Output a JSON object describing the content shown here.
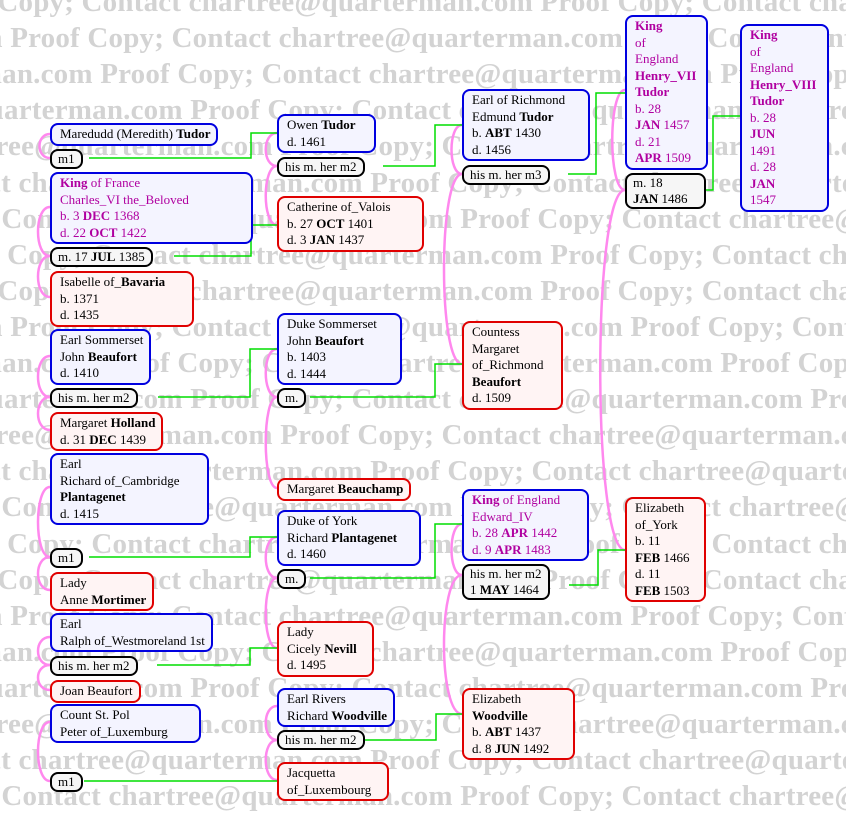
{
  "watermark": {
    "text": "Proof Copy; Contact chartree@quarterman.com"
  },
  "colors": {
    "male_border": "#0000e0",
    "female_border": "#e00000",
    "marriage_border": "#000000",
    "royal_text": "#b000a0",
    "descent_line": "#00dd00",
    "spouse_line": "#ff88ee",
    "watermark": "#d3d3d3"
  },
  "people": {
    "maredudd": {
      "lines": [
        {
          "pre": "Maredudd (Meredith) ",
          "bold": "Tudor",
          "post": ""
        }
      ]
    },
    "charles_vi": {
      "royal": true,
      "lines": [
        {
          "pre": "",
          "bold": "King",
          "post": " of France"
        },
        {
          "pre": "Charles_VI the_Beloved",
          "bold": "",
          "post": ""
        },
        {
          "pre": "b. 3 ",
          "bold": "DEC",
          "post": " 1368"
        },
        {
          "pre": "d. 22 ",
          "bold": "OCT",
          "post": " 1422"
        }
      ]
    },
    "isabelle": {
      "lines": [
        {
          "pre": "Isabelle of_",
          "bold": "Bavaria",
          "post": ""
        },
        {
          "pre": "b. 1371",
          "bold": "",
          "post": ""
        },
        {
          "pre": "d. 1435",
          "bold": "",
          "post": ""
        }
      ]
    },
    "john_beaufort_earl": {
      "lines": [
        {
          "pre": "Earl Sommerset",
          "bold": "",
          "post": ""
        },
        {
          "pre": "John ",
          "bold": "Beaufort",
          "post": ""
        },
        {
          "pre": "d. 1410",
          "bold": "",
          "post": ""
        }
      ]
    },
    "margaret_holland": {
      "lines": [
        {
          "pre": "Margaret ",
          "bold": "Holland",
          "post": ""
        },
        {
          "pre": "d. 31 ",
          "bold": "DEC",
          "post": " 1439"
        }
      ]
    },
    "richard_cambridge": {
      "lines": [
        {
          "pre": "Earl",
          "bold": "",
          "post": ""
        },
        {
          "pre": "Richard of_Cambridge",
          "bold": "",
          "post": ""
        },
        {
          "pre": "",
          "bold": "Plantagenet",
          "post": ""
        },
        {
          "pre": "d. 1415",
          "bold": "",
          "post": ""
        }
      ]
    },
    "anne_mortimer": {
      "lines": [
        {
          "pre": "Lady",
          "bold": "",
          "post": ""
        },
        {
          "pre": "Anne ",
          "bold": "Mortimer",
          "post": ""
        }
      ]
    },
    "ralph_westmoreland": {
      "lines": [
        {
          "pre": "Earl",
          "bold": "",
          "post": ""
        },
        {
          "pre": "Ralph of_Westmoreland 1st",
          "bold": "",
          "post": ""
        }
      ]
    },
    "joan_beaufort": {
      "lines": [
        {
          "pre": "Joan Beaufort",
          "bold": "",
          "post": ""
        }
      ]
    },
    "peter_luxemburg": {
      "lines": [
        {
          "pre": "Count St. Pol",
          "bold": "",
          "post": ""
        },
        {
          "pre": "Peter of_Luxemburg",
          "bold": "",
          "post": ""
        }
      ]
    },
    "owen_tudor": {
      "lines": [
        {
          "pre": "Owen ",
          "bold": "Tudor",
          "post": ""
        },
        {
          "pre": "d. 1461",
          "bold": "",
          "post": ""
        }
      ]
    },
    "catherine_valois": {
      "lines": [
        {
          "pre": "Catherine of_Valois",
          "bold": "",
          "post": ""
        },
        {
          "pre": "b. 27 ",
          "bold": "OCT",
          "post": " 1401"
        },
        {
          "pre": "d. 3 ",
          "bold": "JAN",
          "post": " 1437"
        }
      ]
    },
    "john_beaufort_duke": {
      "lines": [
        {
          "pre": "Duke Sommerset",
          "bold": "",
          "post": ""
        },
        {
          "pre": "John ",
          "bold": "Beaufort",
          "post": ""
        },
        {
          "pre": "b. 1403",
          "bold": "",
          "post": ""
        },
        {
          "pre": "d. 1444",
          "bold": "",
          "post": ""
        }
      ]
    },
    "margaret_beauchamp": {
      "lines": [
        {
          "pre": "Margaret ",
          "bold": "Beauchamp",
          "post": ""
        }
      ]
    },
    "richard_york": {
      "lines": [
        {
          "pre": "Duke of York",
          "bold": "",
          "post": ""
        },
        {
          "pre": "Richard ",
          "bold": "Plantagenet",
          "post": ""
        },
        {
          "pre": "d. 1460",
          "bold": "",
          "post": ""
        }
      ]
    },
    "cicely_nevill": {
      "lines": [
        {
          "pre": "Lady",
          "bold": "",
          "post": ""
        },
        {
          "pre": "Cicely ",
          "bold": "Nevill",
          "post": ""
        },
        {
          "pre": "d. 1495",
          "bold": "",
          "post": ""
        }
      ]
    },
    "richard_woodville": {
      "lines": [
        {
          "pre": "Earl Rivers",
          "bold": "",
          "post": ""
        },
        {
          "pre": "Richard ",
          "bold": "Woodville",
          "post": ""
        }
      ]
    },
    "jacquetta": {
      "lines": [
        {
          "pre": "Jacquetta",
          "bold": "",
          "post": ""
        },
        {
          "pre": "of_Luxembourg",
          "bold": "",
          "post": ""
        }
      ]
    },
    "edmund_tudor": {
      "lines": [
        {
          "pre": "Earl of Richmond",
          "bold": "",
          "post": ""
        },
        {
          "pre": "Edmund ",
          "bold": "Tudor",
          "post": ""
        },
        {
          "pre": "b. ",
          "bold": "ABT",
          "post": " 1430"
        },
        {
          "pre": "d. 1456",
          "bold": "",
          "post": ""
        }
      ]
    },
    "margaret_beaufort": {
      "lines": [
        {
          "pre": "Countess",
          "bold": "",
          "post": ""
        },
        {
          "pre": "Margaret",
          "bold": "",
          "post": ""
        },
        {
          "pre": "of_Richmond",
          "bold": "",
          "post": ""
        },
        {
          "pre": "",
          "bold": "Beaufort",
          "post": ""
        },
        {
          "pre": "d. 1509",
          "bold": "",
          "post": ""
        }
      ]
    },
    "edward_iv": {
      "royal": true,
      "lines": [
        {
          "pre": "",
          "bold": "King",
          "post": " of England"
        },
        {
          "pre": "Edward_IV",
          "bold": "",
          "post": ""
        },
        {
          "pre": "b. 28 ",
          "bold": "APR",
          "post": " 1442"
        },
        {
          "pre": "d. 9 ",
          "bold": "APR",
          "post": " 1483"
        }
      ]
    },
    "elizabeth_woodville": {
      "lines": [
        {
          "pre": "Elizabeth",
          "bold": "",
          "post": ""
        },
        {
          "pre": "",
          "bold": "Woodville",
          "post": ""
        },
        {
          "pre": "b. ",
          "bold": "ABT",
          "post": " 1437"
        },
        {
          "pre": "d. 8 ",
          "bold": "JUN",
          "post": " 1492"
        }
      ]
    },
    "henry_vii": {
      "royal": true,
      "lines": [
        {
          "pre": "",
          "bold": "King",
          "post": ""
        },
        {
          "pre": "of",
          "bold": "",
          "post": ""
        },
        {
          "pre": "England",
          "bold": "",
          "post": ""
        },
        {
          "pre": "",
          "bold": "Henry_VII",
          "post": ""
        },
        {
          "pre": "",
          "bold": "Tudor",
          "post": ""
        },
        {
          "pre": "b. 28",
          "bold": "",
          "post": ""
        },
        {
          "pre": "",
          "bold": "JAN",
          "post": " 1457"
        },
        {
          "pre": "d. 21",
          "bold": "",
          "post": ""
        },
        {
          "pre": "",
          "bold": "APR",
          "post": " 1509"
        }
      ]
    },
    "elizabeth_york": {
      "lines": [
        {
          "pre": "Elizabeth",
          "bold": "",
          "post": ""
        },
        {
          "pre": "of_York",
          "bold": "",
          "post": ""
        },
        {
          "pre": "b. 11",
          "bold": "",
          "post": ""
        },
        {
          "pre": "",
          "bold": "FEB",
          "post": " 1466"
        },
        {
          "pre": "d. 11",
          "bold": "",
          "post": ""
        },
        {
          "pre": "",
          "bold": "FEB",
          "post": " 1503"
        }
      ]
    },
    "henry_viii": {
      "royal": true,
      "lines": [
        {
          "pre": "",
          "bold": "King",
          "post": ""
        },
        {
          "pre": "of",
          "bold": "",
          "post": ""
        },
        {
          "pre": "England",
          "bold": "",
          "post": ""
        },
        {
          "pre": "",
          "bold": "Henry_VIII",
          "post": ""
        },
        {
          "pre": "",
          "bold": "Tudor",
          "post": ""
        },
        {
          "pre": "b. 28",
          "bold": "",
          "post": ""
        },
        {
          "pre": "",
          "bold": "JUN",
          "post": ""
        },
        {
          "pre": "1491",
          "bold": "",
          "post": ""
        },
        {
          "pre": "d. 28",
          "bold": "",
          "post": ""
        },
        {
          "pre": "",
          "bold": "JAN",
          "post": ""
        },
        {
          "pre": "1547",
          "bold": "",
          "post": ""
        }
      ]
    }
  },
  "marriages": {
    "maredudd_m": {
      "lines": [
        {
          "pre": "m1",
          "bold": "",
          "post": ""
        }
      ]
    },
    "charles_isabelle_m": {
      "lines": [
        {
          "pre": "m. 17 ",
          "bold": "JUL",
          "post": " 1385"
        }
      ]
    },
    "beaufort_holland_m": {
      "lines": [
        {
          "pre": "his m. her m2",
          "bold": "",
          "post": ""
        }
      ]
    },
    "cambridge_mortimer_m": {
      "lines": [
        {
          "pre": "m1",
          "bold": "",
          "post": ""
        }
      ]
    },
    "ralph_joan_m": {
      "lines": [
        {
          "pre": "his m. her m2",
          "bold": "",
          "post": ""
        }
      ]
    },
    "peter_m": {
      "lines": [
        {
          "pre": "m1",
          "bold": "",
          "post": ""
        }
      ]
    },
    "owen_catherine_m": {
      "lines": [
        {
          "pre": "his m. her m2",
          "bold": "",
          "post": ""
        }
      ]
    },
    "duke_beaufort_m": {
      "lines": [
        {
          "pre": "m.",
          "bold": "",
          "post": ""
        }
      ]
    },
    "york_nevill_m": {
      "lines": [
        {
          "pre": "m.",
          "bold": "",
          "post": ""
        }
      ]
    },
    "woodville_jacquetta_m": {
      "lines": [
        {
          "pre": "his m. her m2",
          "bold": "",
          "post": ""
        }
      ]
    },
    "edmund_margaret_m": {
      "lines": [
        {
          "pre": "his m. her m3",
          "bold": "",
          "post": ""
        }
      ]
    },
    "edward_elizabeth_m": {
      "lines": [
        {
          "pre": "his m. her m2",
          "bold": "",
          "post": ""
        },
        {
          "pre": "1 ",
          "bold": "MAY",
          "post": " 1464"
        }
      ]
    },
    "henry_elizabeth_m": {
      "lines": [
        {
          "pre": "m. 18",
          "bold": "",
          "post": ""
        },
        {
          "pre": "",
          "bold": "JAN",
          "post": " 1486"
        }
      ]
    }
  }
}
